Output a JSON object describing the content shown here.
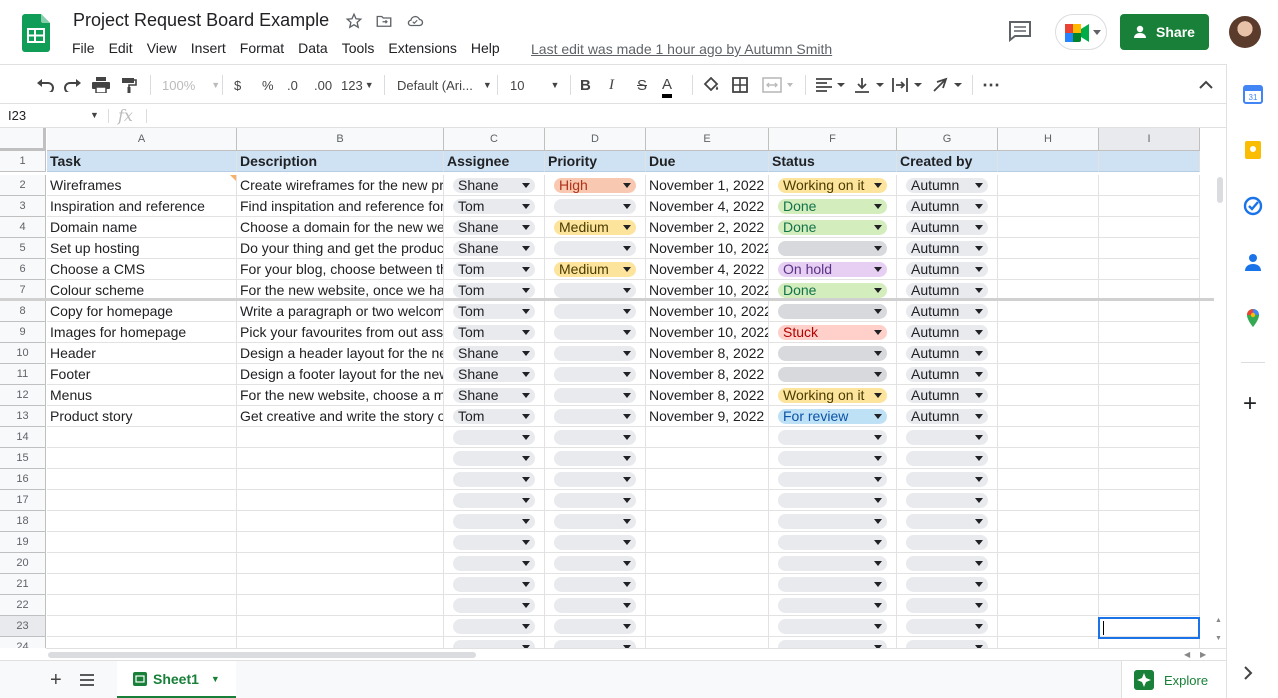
{
  "doc": {
    "title": "Project Request Board Example",
    "last_edit": "Last edit was made 1 hour ago by Autumn Smith"
  },
  "menu": [
    "File",
    "Edit",
    "View",
    "Insert",
    "Format",
    "Data",
    "Tools",
    "Extensions",
    "Help"
  ],
  "share_label": "Share",
  "toolbar": {
    "zoom": "100%",
    "currency": "$",
    "percent": "%",
    "dec_less": ".0",
    "dec_more": ".00",
    "format_more": "123",
    "font": "Default (Ari...",
    "font_size": "10",
    "bold": "B",
    "italic": "I",
    "strike": "S",
    "text_color": "A",
    "more": "⋯"
  },
  "formula": {
    "cell_ref": "I23",
    "fx": "fx",
    "value": ""
  },
  "columns": [
    "A",
    "B",
    "C",
    "D",
    "E",
    "F",
    "G",
    "H",
    "I"
  ],
  "headers": [
    "Task",
    "Description",
    "Assignee",
    "Priority",
    "Due",
    "Status",
    "Created by"
  ],
  "rows": [
    {
      "task": "Wireframes",
      "desc": "Create wireframes for the new pro",
      "assignee": "Shane",
      "priority": "High",
      "due": "November 1, 2022",
      "status": "Working on it",
      "created": "Autumn"
    },
    {
      "task": "Inspiration and reference",
      "desc": "Find inspitation and reference for t",
      "assignee": "Tom",
      "priority": "",
      "due": "November 4, 2022",
      "status": "Done",
      "created": "Autumn"
    },
    {
      "task": "Domain name",
      "desc": "Choose a domain for the new web",
      "assignee": "Shane",
      "priority": "Medium",
      "due": "November 2, 2022",
      "status": "Done",
      "created": "Autumn"
    },
    {
      "task": "Set up hosting",
      "desc": "Do your thing and get the product",
      "assignee": "Shane",
      "priority": "",
      "due": "November 10, 2022",
      "status": "",
      "created": "Autumn"
    },
    {
      "task": "Choose a CMS",
      "desc": "For your blog, choose between the",
      "assignee": "Tom",
      "priority": "Medium",
      "due": "November 4, 2022",
      "status": "On hold",
      "created": "Autumn"
    },
    {
      "task": "Colour scheme",
      "desc": "For the new website, once we hav",
      "assignee": "Tom",
      "priority": "",
      "due": "November 10, 2022",
      "status": "Done",
      "created": "Autumn"
    },
    {
      "task": "Copy for homepage",
      "desc": "Write a paragraph or two welcomir",
      "assignee": "Tom",
      "priority": "",
      "due": "November 10, 2022",
      "status": "",
      "created": "Autumn"
    },
    {
      "task": "Images for homepage",
      "desc": "Pick your favourites from out asse",
      "assignee": "Tom",
      "priority": "",
      "due": "November 10, 2022",
      "status": "Stuck",
      "created": "Autumn"
    },
    {
      "task": "Header",
      "desc": "Design a header layout for the nev",
      "assignee": "Shane",
      "priority": "",
      "due": "November 8, 2022",
      "status": "",
      "created": "Autumn"
    },
    {
      "task": "Footer",
      "desc": "Design a footer layout for the new",
      "assignee": "Shane",
      "priority": "",
      "due": "November 8, 2022",
      "status": "",
      "created": "Autumn"
    },
    {
      "task": "Menus",
      "desc": "For the new website, choose a me",
      "assignee": "Shane",
      "priority": "",
      "due": "November 8, 2022",
      "status": "Working on it",
      "created": "Autumn"
    },
    {
      "task": "Product story",
      "desc": "Get creative and write the story of",
      "assignee": "Tom",
      "priority": "",
      "due": "November 9, 2022",
      "status": "For review",
      "created": "Autumn"
    }
  ],
  "row_numbers": [
    "1",
    "2",
    "3",
    "4",
    "5",
    "6",
    "7",
    "8",
    "9",
    "10",
    "11",
    "12",
    "13",
    "14",
    "15",
    "16",
    "17",
    "18",
    "19",
    "20",
    "21",
    "22",
    "23",
    "24"
  ],
  "chip_colors": {
    "High": "#f8c9b0",
    "Medium": "#fde49c",
    "Working on it": "#fde49c",
    "Done": "#d4edbc",
    "On hold": "#e6cff2",
    "Stuck": "#ffcfc9",
    "For review": "#bfe1f6",
    "empty": "#e8eaed"
  },
  "chip_text_colors": {
    "High": "#b1311a",
    "Medium": "#4a3b00",
    "Working on it": "#4a3b00",
    "Done": "#11734b",
    "On hold": "#5a3286",
    "Stuck": "#b10202",
    "For review": "#0a53a8"
  },
  "sheet": {
    "name": "Sheet1"
  },
  "explore_label": "Explore"
}
